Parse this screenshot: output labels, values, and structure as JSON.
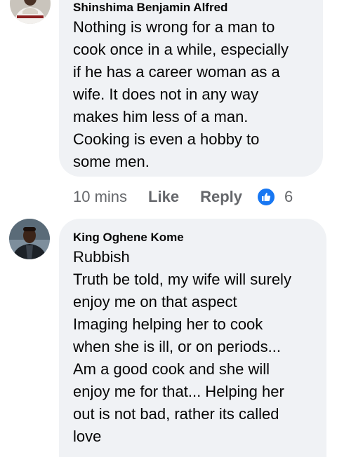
{
  "comments": [
    {
      "author": "Shinshima Benjamin Alfred",
      "text": "Nothing is wrong for a man to\ncook once in a while, especially\nif he has a career woman as a\nwife. It does not in any way\nmakes him less of a man.\nCooking is even a hobby to\nsome men.",
      "actions": {
        "time": "10 mins",
        "like": "Like",
        "reply": "Reply",
        "reaction_icon": "like-icon",
        "reaction_count": "6"
      }
    },
    {
      "author": "King Oghene Kome",
      "text": "Rubbish\nTruth be told, my wife will surely\nenjoy me on that aspect\nImaging helping her to cook\nwhen she is ill, or on periods...\nAm a good cook and she will\nenjoy me for that... Helping her\nout is not bad, rather its called\nlove"
    }
  ],
  "colors": {
    "bubble": "#f0f2f5",
    "meta_text": "#65676b",
    "like_badge": "#1877f2"
  }
}
